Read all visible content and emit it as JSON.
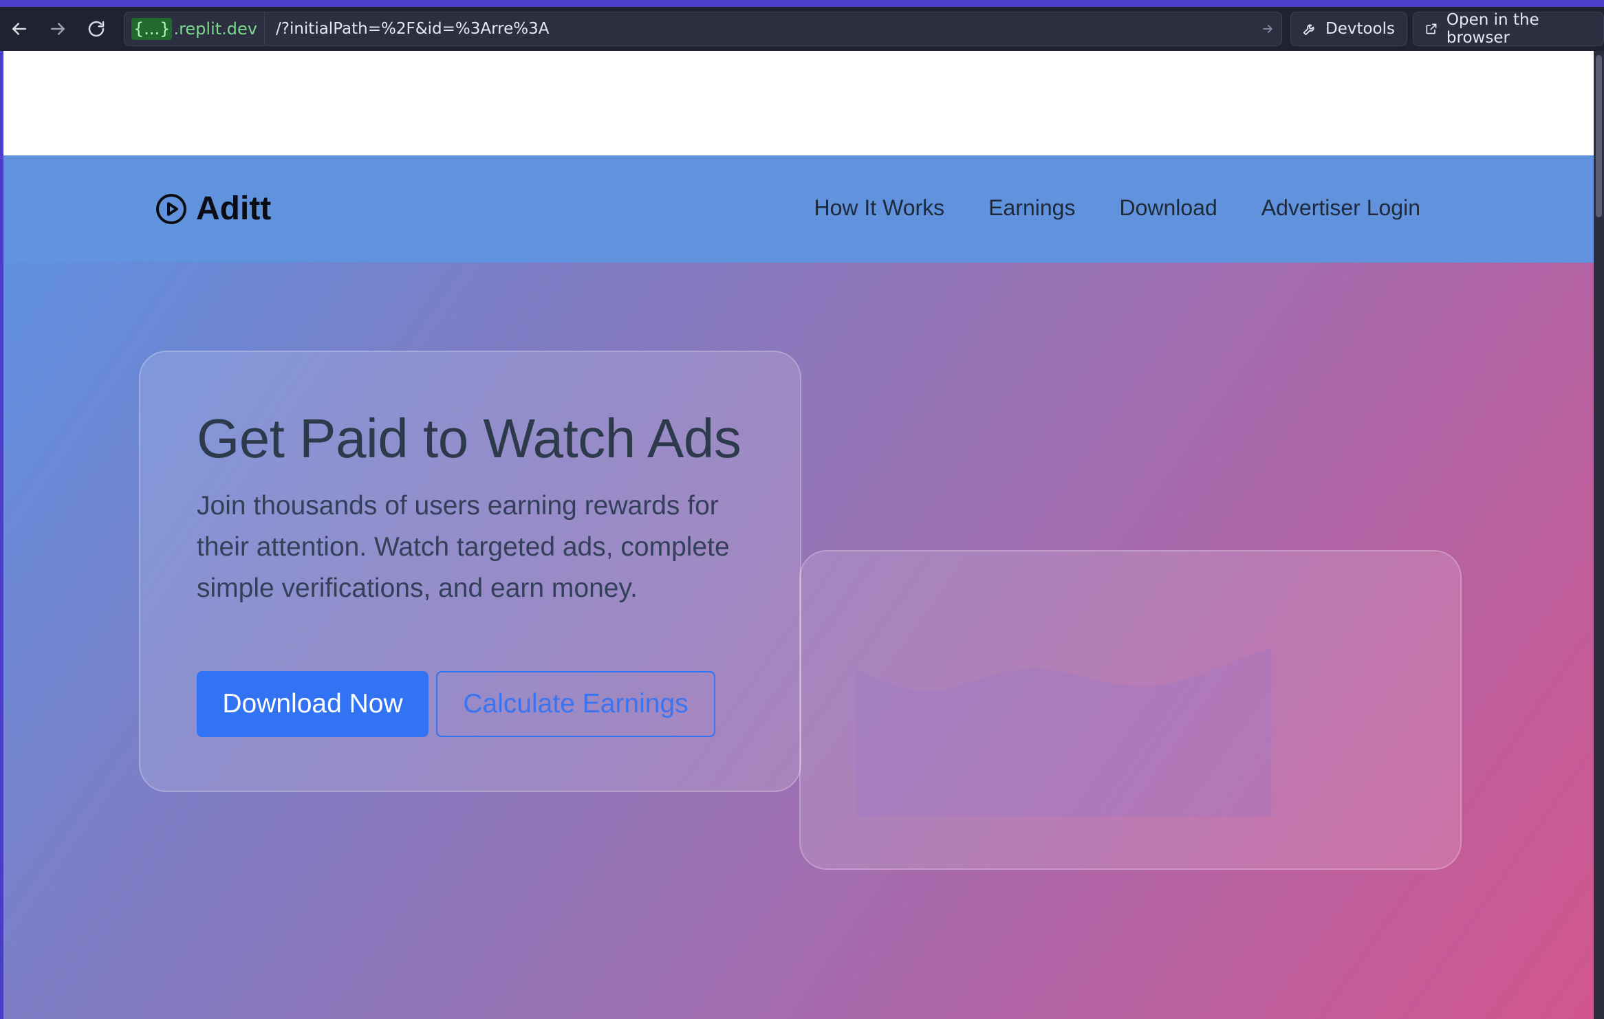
{
  "browser": {
    "url_domain_prefix": "{...}",
    "url_domain": ".replit.dev",
    "url_path": "/?initialPath=%2F&id=%3Arre%3A",
    "devtools_label": "Devtools",
    "open_browser_label": "Open in the browser"
  },
  "site": {
    "brand": "Aditt",
    "nav": [
      {
        "label": "How It Works"
      },
      {
        "label": "Earnings"
      },
      {
        "label": "Download"
      },
      {
        "label": "Advertiser Login"
      }
    ]
  },
  "hero": {
    "title": "Get Paid to Watch Ads",
    "description": "Join thousands of users earning rewards for their attention. Watch targeted ads, complete simple verifications, and earn money.",
    "primary_cta": "Download Now",
    "secondary_cta": "Calculate Earnings"
  },
  "colors": {
    "header_bg": "#6192dd",
    "primary": "#3273f3",
    "gradient_start": "#5f8fe0",
    "gradient_end": "#d2568e"
  }
}
